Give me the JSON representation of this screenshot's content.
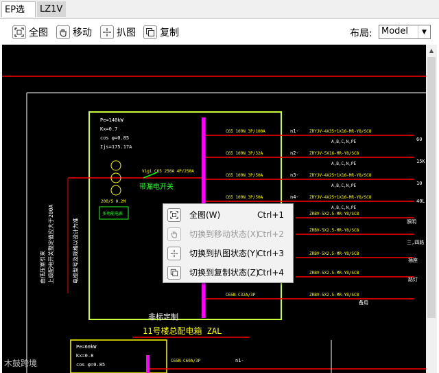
{
  "tabs": [
    {
      "label": "EP选型",
      "active": true
    },
    {
      "label": "LZ1V",
      "active": false
    }
  ],
  "toolbar": {
    "full_view": "全图",
    "move": "移动",
    "grab": "扒图",
    "copy": "复制",
    "layout_label": "布局:",
    "layout_value": "Model"
  },
  "context_menu": {
    "items": [
      {
        "label": "全图(W)",
        "shortcut": "Ctrl+1",
        "enabled": true,
        "icon": "full-view-icon"
      },
      {
        "label": "切换到移动状态(X)",
        "shortcut": "Ctrl+2",
        "enabled": false,
        "icon": "hand-icon"
      },
      {
        "label": "切换到扒图状态(Y)",
        "shortcut": "Ctrl+3",
        "enabled": true,
        "icon": "crosshair-icon"
      },
      {
        "label": "切换到复制状态(Z)",
        "shortcut": "Ctrl+4",
        "enabled": true,
        "icon": "copy-icon"
      }
    ]
  },
  "drawing": {
    "panel_title": "11号楼总配电箱 ZAL",
    "non_standard": "非标定制",
    "params": [
      "Pe=140kW",
      "Kx=0.7",
      "cos φ=0.85",
      "Ijs=175.17A"
    ],
    "params2": [
      "Pe=60kW",
      "Kx=0.8",
      "cos φ=0.85"
    ],
    "vertical_text_1": "由低压室引来",
    "vertical_text_2": "上级配电开关整定值应大于200A",
    "vertical_text_3": "电缆型号及规格以设计为准",
    "vertical_text_4": "带漏电开关",
    "main_breaker": "Vigi C65 250A 4P/250A",
    "spd": "200/5 0.2M",
    "meter": "多功能电表",
    "circuit_labels": [
      "n1-",
      "n2-",
      "n3-",
      "n4-",
      "n5-",
      "n6-",
      "n7-",
      "n8-",
      "n9-"
    ],
    "breakers": [
      "C65 100N 3P/100A",
      "C65 100N 3P/32A",
      "C65 100N 3P/50A",
      "C65 100N 3P/50A",
      "C65N-C32 3P",
      "C65N-C32 3P",
      "C65N-C32A/3P",
      "C65N-C32A/3P",
      "C65N-C32A/3P"
    ],
    "cables": [
      "ZRYJV-4X35+1X16-MR-Y8/SC8",
      "ZRYJV-5X16-MR-Y8/SC8",
      "ZRYJV-4X25+1X16-MR-Y8/SC8",
      "ZRYJV-4X25+1X16-MR-Y8/SC8",
      "ZRBV-5X2.5-MR-Y8/SC8",
      "ZRBV-5X2.5-MR-Y8/SC8",
      "ZRBV-5X2.5-MR-Y8/SCB",
      "ZRBV-5X2.5-MR-Y8/SCB",
      "ZRBV-5X2.5-MR-Y8/SC8"
    ],
    "phases": [
      "A,B,C,N,PE",
      "A,B,C,N,PE",
      "A,B,C,N,PE",
      "A,B,C,N,PE"
    ],
    "right_values": [
      "60",
      "15K",
      "10",
      "40L",
      "照明",
      "三,四路",
      "插座",
      "路灯"
    ],
    "spare": "备用",
    "sub_breaker": "C65N-C60A/3P",
    "sub_label": "n1-"
  },
  "watermark": "木鼓跨境",
  "colors": {
    "canvas": "#000000",
    "red": "#ff0000",
    "yellow": "#ffff00",
    "green": "#22ff22",
    "magenta": "#ff00ff",
    "white": "#ffffff",
    "cyan": "#00ffff"
  }
}
